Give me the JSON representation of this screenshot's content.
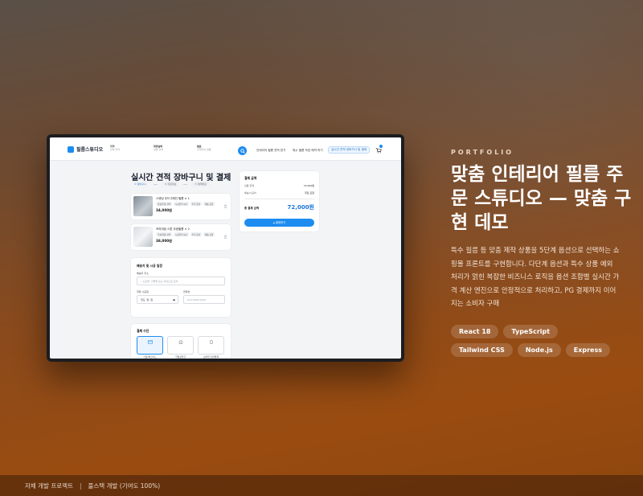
{
  "app": {
    "logo": "필름스튜디오",
    "search": [
      {
        "label": "지역",
        "placeholder": "전체 지역"
      },
      {
        "label": "희망날짜",
        "placeholder": "날짜 선택"
      },
      {
        "label": "필름",
        "placeholder": "인테리어 필름"
      }
    ],
    "nav": [
      "인테리어 필름 견적 받기",
      "특수 필름 작업 예약 하기"
    ],
    "nav_active": "실시간 견적 장바구니 및 결제",
    "page_title": "실시간 견적 장바구니 및 결제",
    "steps": [
      "① 장바구니",
      "② 주문정보",
      "③ 결제완료"
    ],
    "items": [
      {
        "name": "스탠딩 우드그레인 필름 × 1",
        "tags": [
          "유광/무광 선택",
          "시공면적 3㎡",
          "추가 옵션",
          "배송 포함"
        ],
        "price": "34,000원"
      },
      {
        "name": "프리미엄 스톤 무광필름 × 2",
        "tags": [
          "무광/유광 선택",
          "시공면적 4㎡",
          "추가 옵션",
          "배송 포함"
        ],
        "price": "38,000원"
      }
    ],
    "shipping": {
      "title": "배송지 및 시공 일정",
      "address_label": "배송지 주소",
      "address_placeholder": "도로명, 건물명 또는 지번으로 검색",
      "date_label": "희망 시공일",
      "date_placeholder": "연도. 월. 일.",
      "phone_label": "연락처",
      "phone_placeholder": "010-0000-0000"
    },
    "payment": {
      "title": "결제 수단",
      "options": [
        "신용/체크카드",
        "무통장입금",
        "모바일 간편결제"
      ]
    },
    "summary": {
      "title": "결제 금액",
      "rows": [
        {
          "label": "상품 합계",
          "value": "72,000원"
        },
        {
          "label": "배송/시공비",
          "value": "무료 포함"
        }
      ],
      "total_label": "총 결제 금액",
      "total_value": "72,000원",
      "button": "결제하기"
    }
  },
  "portfolio": {
    "eyebrow": "PORTFOLIO",
    "headline": "맞춤 인테리어 필름 주문 스튜디오 — 맞춤 구현 데모",
    "description": "특수 필름 등 맞춤 제작 상품을 5단계 옵션으로 선택하는 쇼핑몰 프론트를 구현합니다. 다단계 옵션과 특수 상품 예외 처리가 얽힌 복잡한 비즈니스 로직을 옵션 조합별 실시간 가격 계산 엔진으로 안정적으로 처리하고, PG 결제까지 이어지는 소비자 구매",
    "stack": [
      "React 18",
      "TypeScript",
      "Tailwind CSS",
      "Node.js",
      "Express"
    ]
  },
  "footer": {
    "left": "자체 개발 프로젝트",
    "right": "풀스택 개발 (기여도 100%)"
  },
  "colors": {
    "accent": "#1d8cf0",
    "background": "#8a4a1c"
  }
}
